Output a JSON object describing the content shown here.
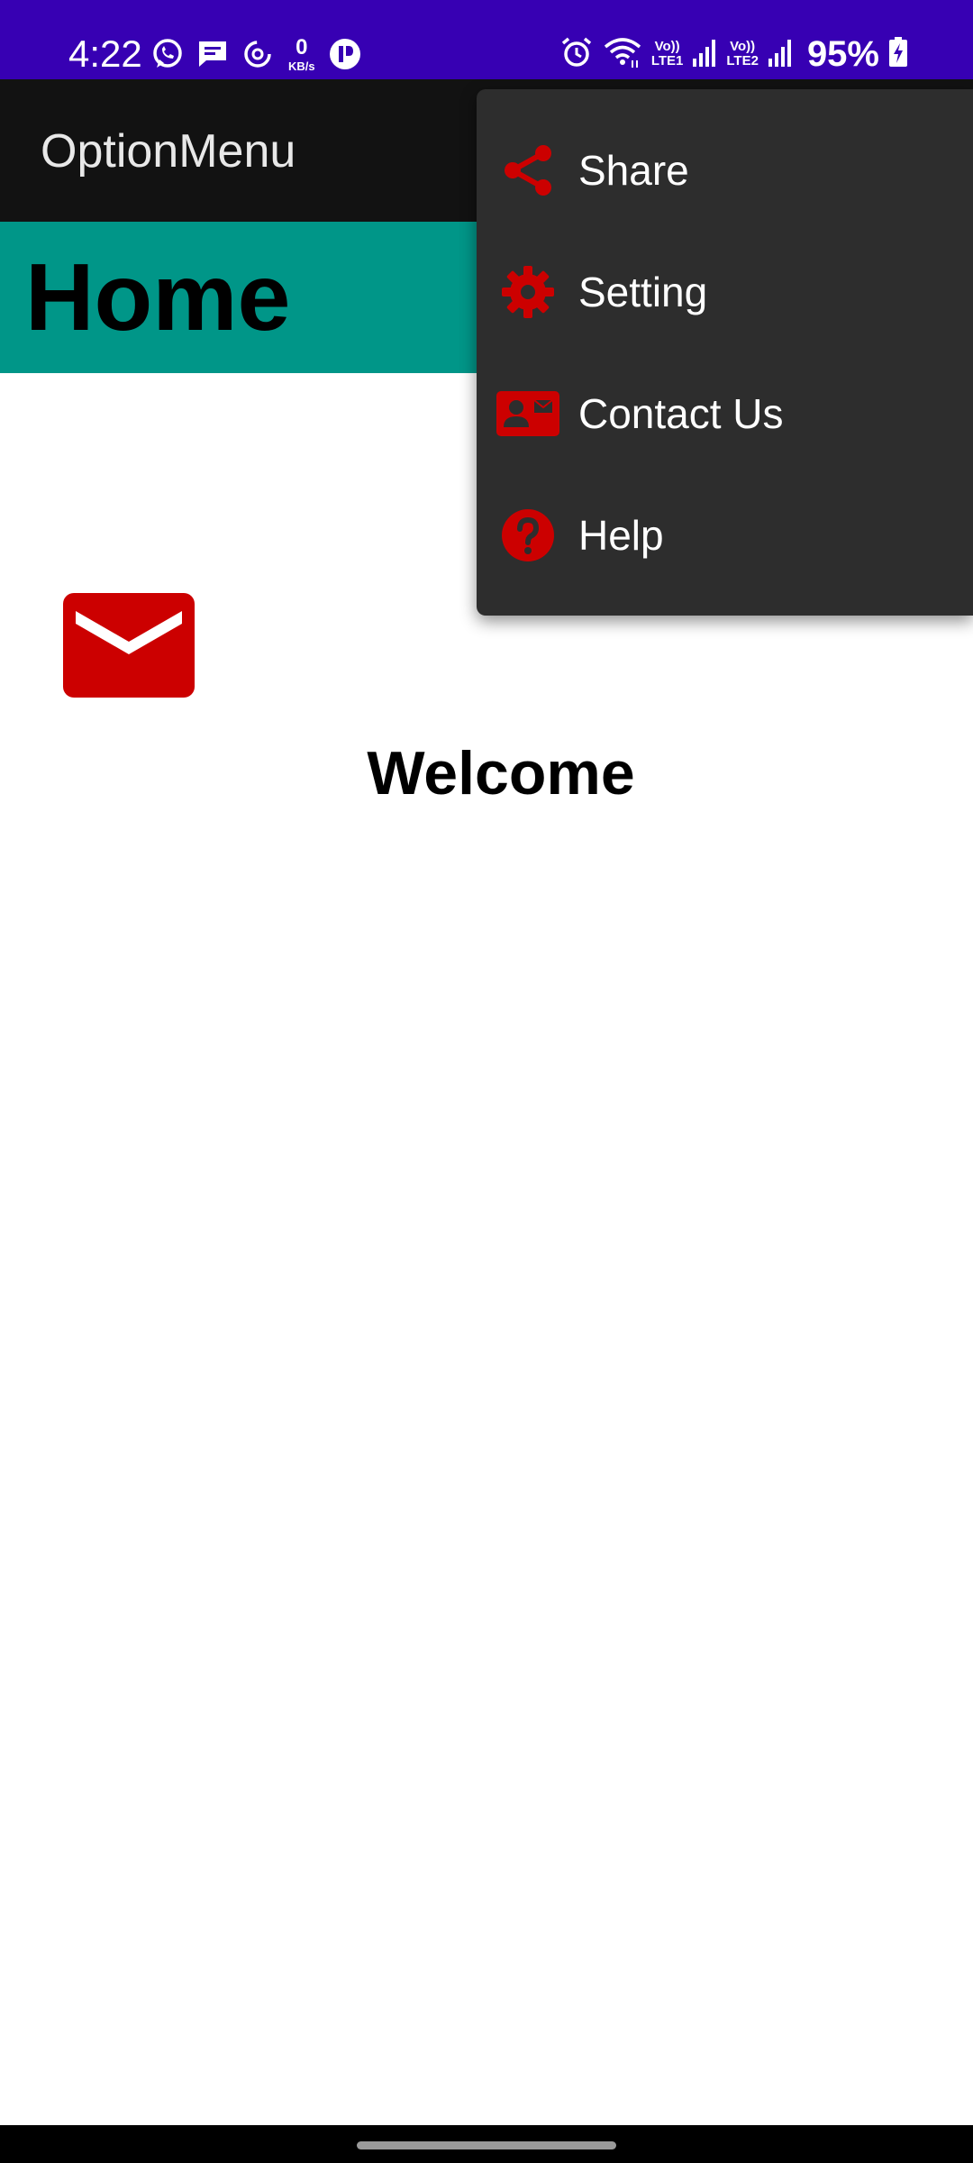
{
  "status_bar": {
    "time": "4:22",
    "net_speed_value": "0",
    "net_speed_unit": "KB/s",
    "sim1_top": "Vo))",
    "sim1_bottom": "LTE1",
    "sim2_top": "Vo))",
    "sim2_bottom": "LTE2",
    "battery": "95%",
    "background_color": "#3700b3",
    "icons": [
      "whatsapp-icon",
      "message-icon",
      "sync-icon",
      "app-icon",
      "alarm-icon",
      "wifi-icon",
      "signal-icon",
      "battery-charging-icon"
    ]
  },
  "app_bar": {
    "title": "OptionMenu",
    "background_color": "#121212"
  },
  "banner": {
    "title": "Home",
    "background_color": "#009688"
  },
  "main": {
    "welcome": "Welcome",
    "icon": "mail-icon",
    "accent_color": "#cc0000"
  },
  "menu": {
    "background_color": "#2d2d2d",
    "items": [
      {
        "label": "Share",
        "icon": "share-icon"
      },
      {
        "label": "Setting",
        "icon": "gear-icon"
      },
      {
        "label": "Contact Us",
        "icon": "contact-card-icon"
      },
      {
        "label": "Help",
        "icon": "help-icon"
      }
    ]
  }
}
